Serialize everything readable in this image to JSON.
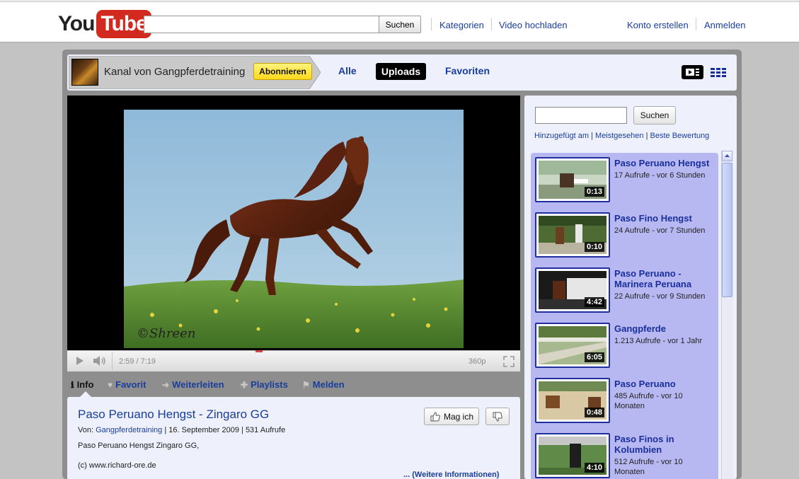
{
  "header": {
    "logo_you": "You",
    "logo_tube": "Tube",
    "search_value": "",
    "search_button": "Suchen",
    "links": [
      "Kategorien",
      "Video hochladen"
    ],
    "account_links": [
      "Konto erstellen",
      "Anmelden"
    ]
  },
  "channel": {
    "name": "Kanal von Gangpferdetraining",
    "subscribe": "Abonnieren",
    "tabs": [
      "Alle",
      "Uploads",
      "Favoriten"
    ],
    "active_tab": "Uploads"
  },
  "player": {
    "time": "2:59 / 7:19",
    "quality": "360p",
    "watermark": "©Shreen"
  },
  "actions": {
    "tabs": [
      {
        "label": "Info",
        "icon": "info-icon"
      },
      {
        "label": "Favorit",
        "icon": "heart-icon"
      },
      {
        "label": "Weiterleiten",
        "icon": "arrow-icon"
      },
      {
        "label": "Playlists",
        "icon": "plus-icon"
      },
      {
        "label": "Melden",
        "icon": "flag-icon"
      }
    ]
  },
  "video": {
    "title": "Paso Peruano Hengst - Zingaro GG",
    "by_label": "Von:",
    "author": "Gangpferdetraining",
    "date": "16. September 2009",
    "views": "531 Aufrufe",
    "description_line1": "Paso Peruano Hengst Zingaro GG,",
    "description_line2": "(c) www.richard-ore.de",
    "more_info": "... (Weitere Informationen)",
    "like_label": "Mag ich"
  },
  "sidebar": {
    "search_value": "",
    "search_button": "Suchen",
    "sort_links": [
      "Hinzugefügt am",
      "Meistgesehen",
      "Beste Bewertung"
    ],
    "videos": [
      {
        "title": "Paso Peruano Hengst",
        "meta": "17 Aufrufe - vor 6 Stunden",
        "duration": "0:13"
      },
      {
        "title": "Paso Fino Hengst",
        "meta": "24 Aufrufe - vor 7 Stunden",
        "duration": "0:10"
      },
      {
        "title": "Paso Peruano - Marinera Peruana",
        "meta": "22 Aufrufe - vor 9 Stunden",
        "duration": "4:42"
      },
      {
        "title": "Gangpferde",
        "meta": "1.213 Aufrufe - vor 1 Jahr",
        "duration": "6:05"
      },
      {
        "title": "Paso Peruano",
        "meta": "485 Aufrufe - vor 10 Monaten",
        "duration": "0:48"
      },
      {
        "title": "Paso Finos in Kolumbien",
        "meta": "512 Aufrufe - vor 10 Monaten",
        "duration": "4:10"
      }
    ]
  },
  "colors": {
    "link": "#1a3e9b",
    "subscribe": "#fed81c",
    "list_panel": "#b7b8f2",
    "brand_red": "#d32a1f"
  }
}
